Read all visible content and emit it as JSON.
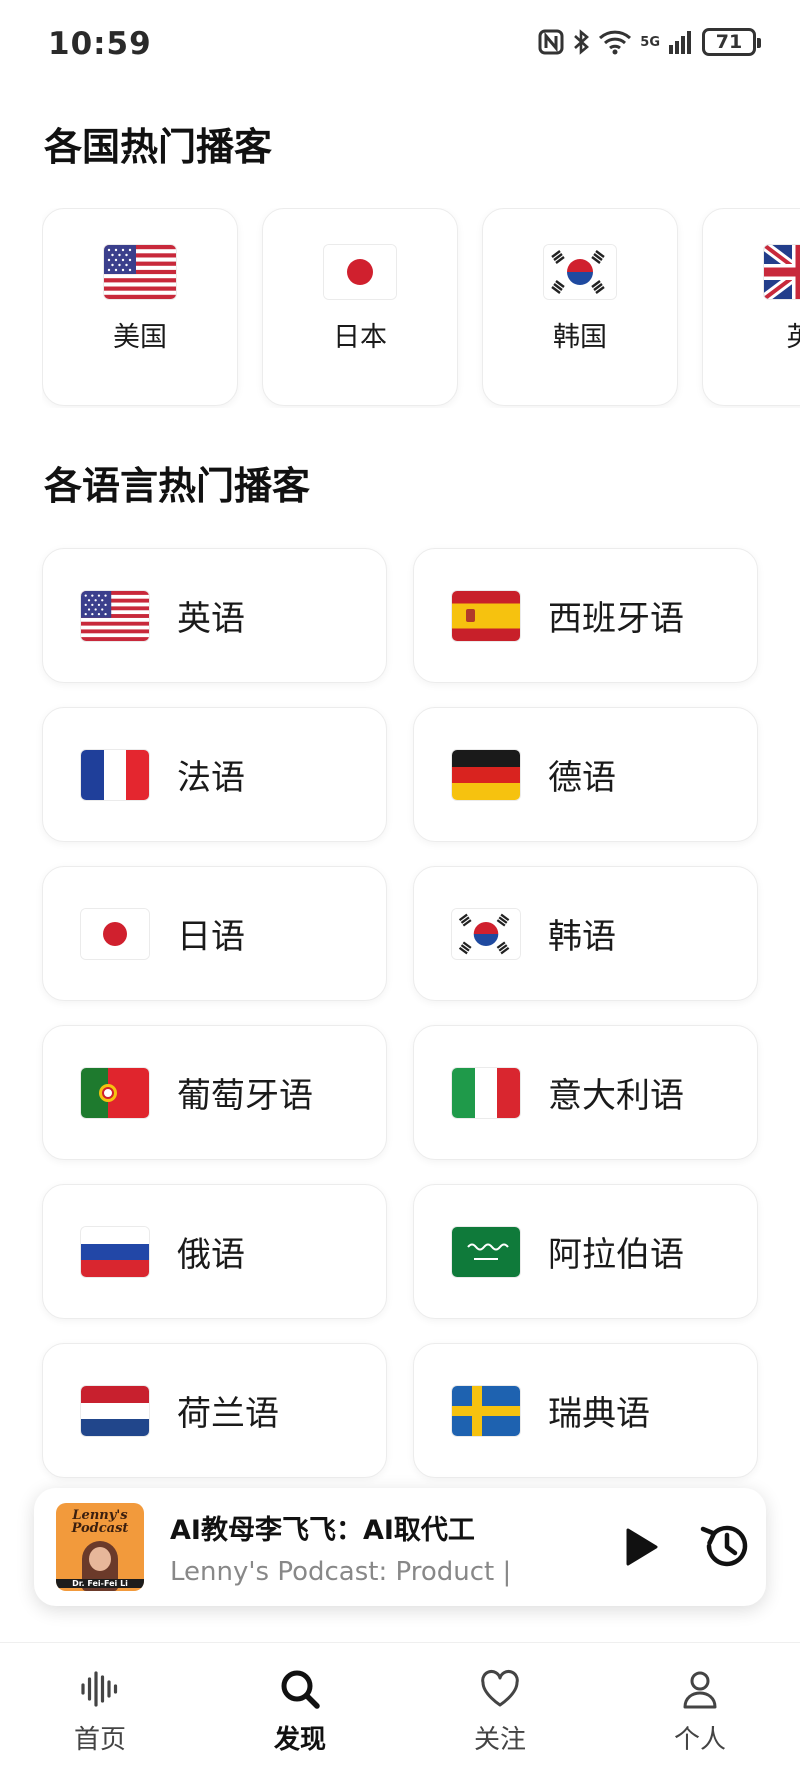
{
  "status_bar": {
    "time": "10:59",
    "network": "5G",
    "battery": "71"
  },
  "countries_section": {
    "title": "各国热门播客",
    "items": [
      {
        "label": "美国",
        "flag": "us-flag"
      },
      {
        "label": "日本",
        "flag": "jp-flag"
      },
      {
        "label": "韩国",
        "flag": "kr-flag"
      },
      {
        "label": "英",
        "flag": "gb-flag"
      }
    ]
  },
  "languages_section": {
    "title": "各语言热门播客",
    "items": [
      {
        "label": "英语",
        "flag": "us-flag"
      },
      {
        "label": "西班牙语",
        "flag": "es-flag"
      },
      {
        "label": "法语",
        "flag": "fr-flag"
      },
      {
        "label": "德语",
        "flag": "de-flag"
      },
      {
        "label": "日语",
        "flag": "jp-flag"
      },
      {
        "label": "韩语",
        "flag": "kr-flag"
      },
      {
        "label": "葡萄牙语",
        "flag": "pt-flag"
      },
      {
        "label": "意大利语",
        "flag": "it-flag"
      },
      {
        "label": "俄语",
        "flag": "ru-flag"
      },
      {
        "label": "阿拉伯语",
        "flag": "sa-flag"
      },
      {
        "label": "荷兰语",
        "flag": "nl-flag"
      },
      {
        "label": "瑞典语",
        "flag": "se-flag"
      }
    ]
  },
  "mini_player": {
    "cover_title": "Lenny's Podcast",
    "cover_name": "Dr. Fei-Fei Li",
    "title": "AI教母李飞飞：AI取代工",
    "subtitle": "Lenny's Podcast: Product |",
    "play_icon": "play-icon",
    "history_icon": "history-icon"
  },
  "bottom_nav": {
    "items": [
      {
        "label": "首页",
        "icon": "waveform-icon",
        "active": false
      },
      {
        "label": "发现",
        "icon": "search-icon",
        "active": true
      },
      {
        "label": "关注",
        "icon": "heart-icon",
        "active": false
      },
      {
        "label": "个人",
        "icon": "person-icon",
        "active": false
      }
    ]
  },
  "colors": {
    "text": "#1a1a1a",
    "subtext": "#888888",
    "card_border": "#ececec"
  }
}
